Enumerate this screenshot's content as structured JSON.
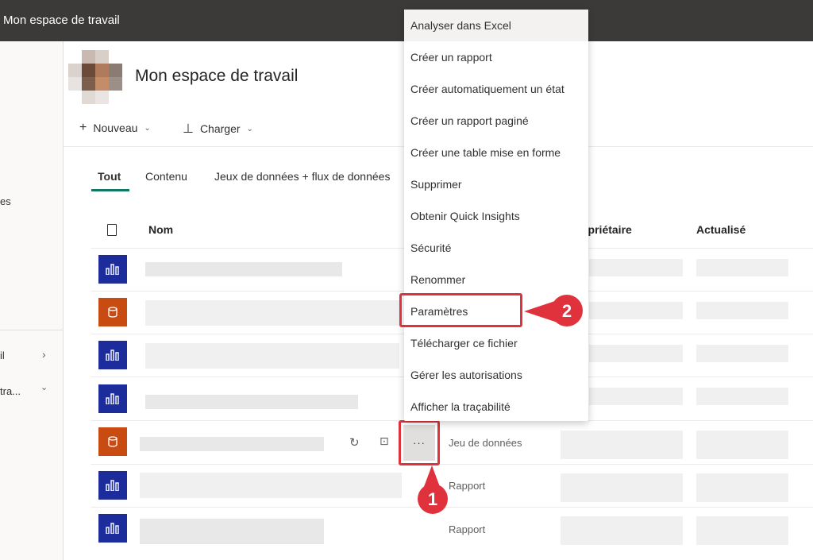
{
  "header": {
    "title": "Mon espace de travail"
  },
  "sidebar": {
    "items": [
      {
        "label": "es"
      },
      {
        "label": "il",
        "chevron": "chevron-right-icon"
      },
      {
        "label": "tra...",
        "chevron": "chevron-down-icon"
      }
    ]
  },
  "workspace": {
    "title": "Mon espace de travail"
  },
  "toolbar": {
    "new_label": "Nouveau",
    "upload_label": "Charger"
  },
  "tabs": [
    {
      "label": "Tout",
      "active": true
    },
    {
      "label": "Contenu"
    },
    {
      "label": "Jeux de données + flux de données"
    }
  ],
  "table": {
    "columns": {
      "name": "Nom",
      "owner": "opriétaire",
      "refreshed": "Actualisé"
    },
    "rows": [
      {
        "type_icon": "report-icon"
      },
      {
        "type_icon": "dataset-icon"
      },
      {
        "type_icon": "report-icon"
      },
      {
        "type_icon": "report-icon"
      },
      {
        "type_icon": "dataset-icon",
        "type_label": "Jeu de données"
      },
      {
        "type_icon": "report-icon",
        "type_label": "Rapport"
      },
      {
        "type_icon": "report-icon",
        "type_label": "Rapport"
      }
    ]
  },
  "row_actions": {
    "more_label": "···"
  },
  "context_menu": {
    "items": [
      "Analyser dans Excel",
      "Créer un rapport",
      "Créer automatiquement un état",
      "Créer un rapport paginé",
      "Créer une table mise en forme",
      "Supprimer",
      "Obtenir Quick Insights",
      "Sécurité",
      "Renommer",
      "Paramètres",
      "Télécharger ce fichier",
      "Gérer les autorisations",
      "Afficher la traçabilité"
    ]
  },
  "annotations": {
    "step1": "1",
    "step2": "2",
    "color": "#e0323c"
  },
  "colors": {
    "accent": "#117865",
    "report": "#1c2d9b",
    "dataset": "#c84b12",
    "topbar": "#3b3a39"
  }
}
